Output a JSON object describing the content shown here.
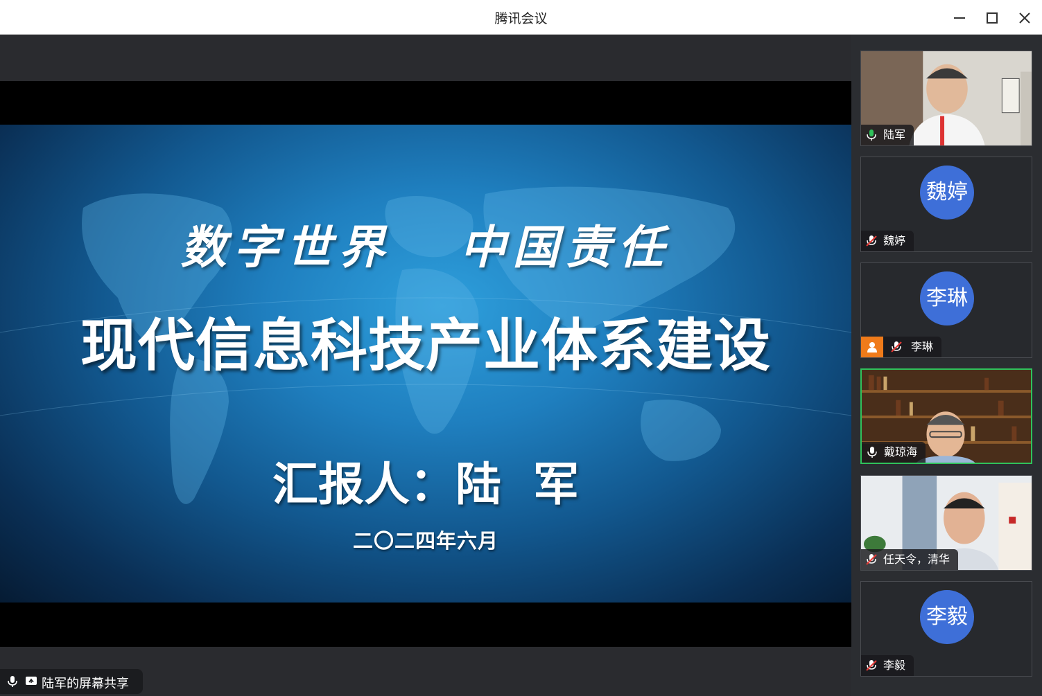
{
  "window": {
    "title": "腾讯会议",
    "controls": [
      "minimize-icon",
      "maximize-icon",
      "close-icon"
    ]
  },
  "slide": {
    "title_line1": "数字世界   中国责任",
    "title_line2": "现代信息科技产业体系建设",
    "reporter": "汇报人：陆  军",
    "date": "二〇二四年六月"
  },
  "share_status": {
    "label": "陆军的屏幕共享",
    "icons": [
      "microphone-icon",
      "screen-share-icon"
    ]
  },
  "participants": [
    {
      "name": "陆军",
      "type": "video",
      "mic": "on"
    },
    {
      "name": "魏婷",
      "type": "avatar",
      "avatar_text": "魏婷",
      "mic": "muted"
    },
    {
      "name": "李琳",
      "type": "avatar",
      "avatar_text": "李琳",
      "mic": "muted",
      "host": true
    },
    {
      "name": "戴琼海",
      "type": "video",
      "mic": "on",
      "speaking": true
    },
    {
      "name": "任天令，清华",
      "type": "video",
      "mic": "muted"
    },
    {
      "name": "李毅",
      "type": "avatar",
      "avatar_text": "李毅",
      "mic": "muted"
    }
  ],
  "colors": {
    "avatar": "#3e6fd8",
    "speaking_border": "#2fc25b",
    "host_badge": "#f07b1a",
    "mic_on": "#2fc25b",
    "mic_muted": "#e53935"
  }
}
